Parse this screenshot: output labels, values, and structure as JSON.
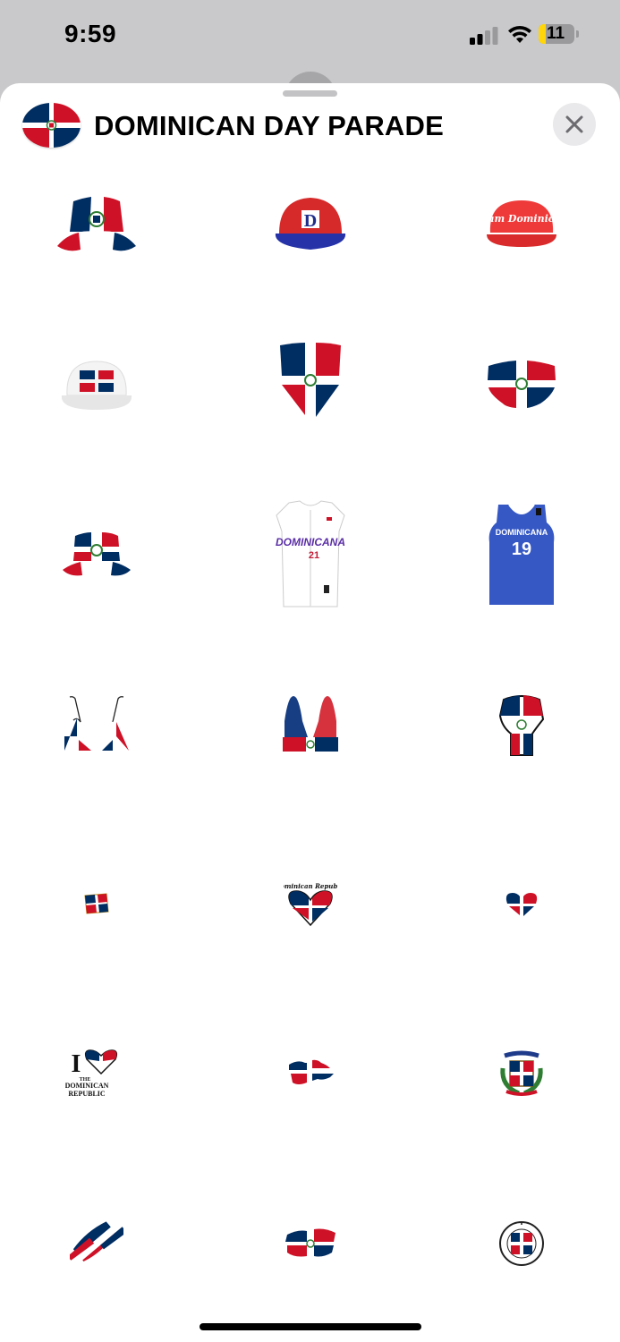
{
  "status_bar": {
    "time": "9:59",
    "battery_level": "11",
    "battery_fraction": 0.11
  },
  "sheet": {
    "title": "DOMINICAN DAY PARADE",
    "header_icon": "dominican-flag-oval-icon",
    "close_icon": "close-icon"
  },
  "colors": {
    "flag_blue": "#002d62",
    "flag_red": "#ce1126",
    "white": "#ffffff"
  },
  "stickers": [
    {
      "name": "bucket-hat-flag-sticker"
    },
    {
      "name": "red-blue-cap-sticker",
      "text": "D"
    },
    {
      "name": "team-dominican-cap-sticker",
      "text": "Team Dominican"
    },
    {
      "name": "white-flag-cap-sticker"
    },
    {
      "name": "flag-neck-gaiter-sticker"
    },
    {
      "name": "flag-face-mask-sticker"
    },
    {
      "name": "flag-bucket-hat-distressed-sticker"
    },
    {
      "name": "white-baseball-jersey-sticker",
      "text": "DOMINICANA",
      "number": "21"
    },
    {
      "name": "blue-basketball-jersey-sticker",
      "text": "DOMINICANA",
      "number": "19"
    },
    {
      "name": "triangle-bikini-top-sticker"
    },
    {
      "name": "bralette-top-sticker"
    },
    {
      "name": "raised-fist-flag-sticker"
    },
    {
      "name": "flag-pin-sticker"
    },
    {
      "name": "dominican-republic-heart-sticker",
      "text": "Dominican Republic"
    },
    {
      "name": "heart-flag-sticker"
    },
    {
      "name": "i-love-dominican-republic-sticker",
      "text": "I",
      "text2": "THE",
      "text3": "DOMINICAN",
      "text4": "REPUBLIC"
    },
    {
      "name": "map-flag-sticker"
    },
    {
      "name": "coat-of-arms-sticker"
    },
    {
      "name": "brush-stroke-flag-diagonal-sticker"
    },
    {
      "name": "brush-stroke-flag-sticker"
    },
    {
      "name": "dominican-republic-round-seal-sticker"
    }
  ]
}
